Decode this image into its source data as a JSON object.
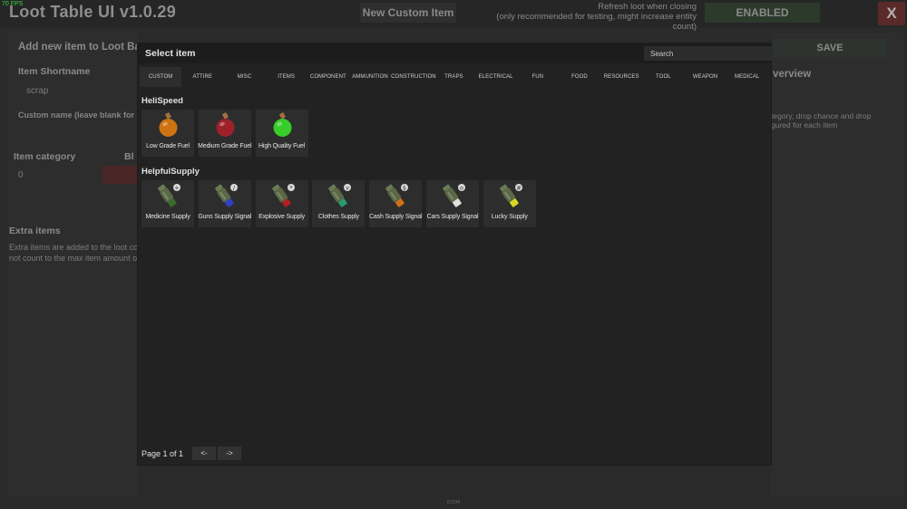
{
  "topbar": {
    "fps": "70 FPS",
    "title": "Loot Table UI v1.0.29",
    "new_item_label": "New Custom Item",
    "refresh_line1": "Refresh loot when closing",
    "refresh_line2": "(only recommended for testing, might increase entity count)",
    "enabled_label": "ENABLED",
    "close_label": "X"
  },
  "left_panel": {
    "heading": "Add new item to Loot Barr",
    "shortname_label": "Item Shortname",
    "shortname_value": "scrap",
    "custom_name_label": "Custom name (leave blank for de",
    "category_label": "Item category",
    "category_value": "0",
    "bl_label": "Bl",
    "extra_heading": "Extra items",
    "extra_line1": "Extra items are added to the loot co",
    "extra_line2": "not count to the max item amount o"
  },
  "right_panel": {
    "save_label": "SAVE",
    "overview_heading": "verview",
    "desc_line1": "tegory, drop chance and drop",
    "desc_line2": "gured for each item"
  },
  "footer_text": "81234",
  "modal": {
    "title": "Select item",
    "search_placeholder": "Search",
    "tabs": [
      "CUSTOM",
      "ATTIRE",
      "MISC",
      "ITEMS",
      "COMPONENT",
      "AMMUNITION",
      "CONSTRUCTION",
      "TRAPS",
      "ELECTRICAL",
      "FUN",
      "FOOD",
      "RESOURCES",
      "TOOL",
      "WEAPON",
      "MEDICAL"
    ],
    "active_tab": "CUSTOM",
    "groups": [
      {
        "name": "HeliSpeed",
        "items": [
          {
            "label": "Low Grade Fuel",
            "icon": "low-grade-fuel-icon",
            "color": "#e07a10"
          },
          {
            "label": "Medium Grade Fuel",
            "icon": "medium-grade-fuel-icon",
            "color": "#a8202a"
          },
          {
            "label": "High Quality Fuel",
            "icon": "high-quality-fuel-icon",
            "color": "#3adf2a"
          }
        ]
      },
      {
        "name": "HelpfulSupply",
        "items": [
          {
            "label": "Medicine Supply",
            "icon": "medicine-supply-icon",
            "color": "#3a6a2a",
            "badge": "+"
          },
          {
            "label": "Guns Supply Signal",
            "icon": "guns-supply-signal-icon",
            "color": "#3040c8",
            "badge": "/"
          },
          {
            "label": "Explosive Supply",
            "icon": "explosive-supply-icon",
            "color": "#b02020",
            "badge": "*"
          },
          {
            "label": "Clothes Supply",
            "icon": "clothes-supply-icon",
            "color": "#2a9a6a",
            "badge": "v"
          },
          {
            "label": "Cash Supply Signal",
            "icon": "cash-supply-signal-icon",
            "color": "#d07018",
            "badge": "$"
          },
          {
            "label": "Cars Supply Signal",
            "icon": "cars-supply-signal-icon",
            "color": "#e0e0e0",
            "badge": "o"
          },
          {
            "label": "Lucky Supply",
            "icon": "lucky-supply-icon",
            "color": "#d8d820",
            "badge": "#"
          }
        ]
      }
    ],
    "page_label": "Page 1 of 1",
    "prev_label": "<-",
    "next_label": "->"
  }
}
